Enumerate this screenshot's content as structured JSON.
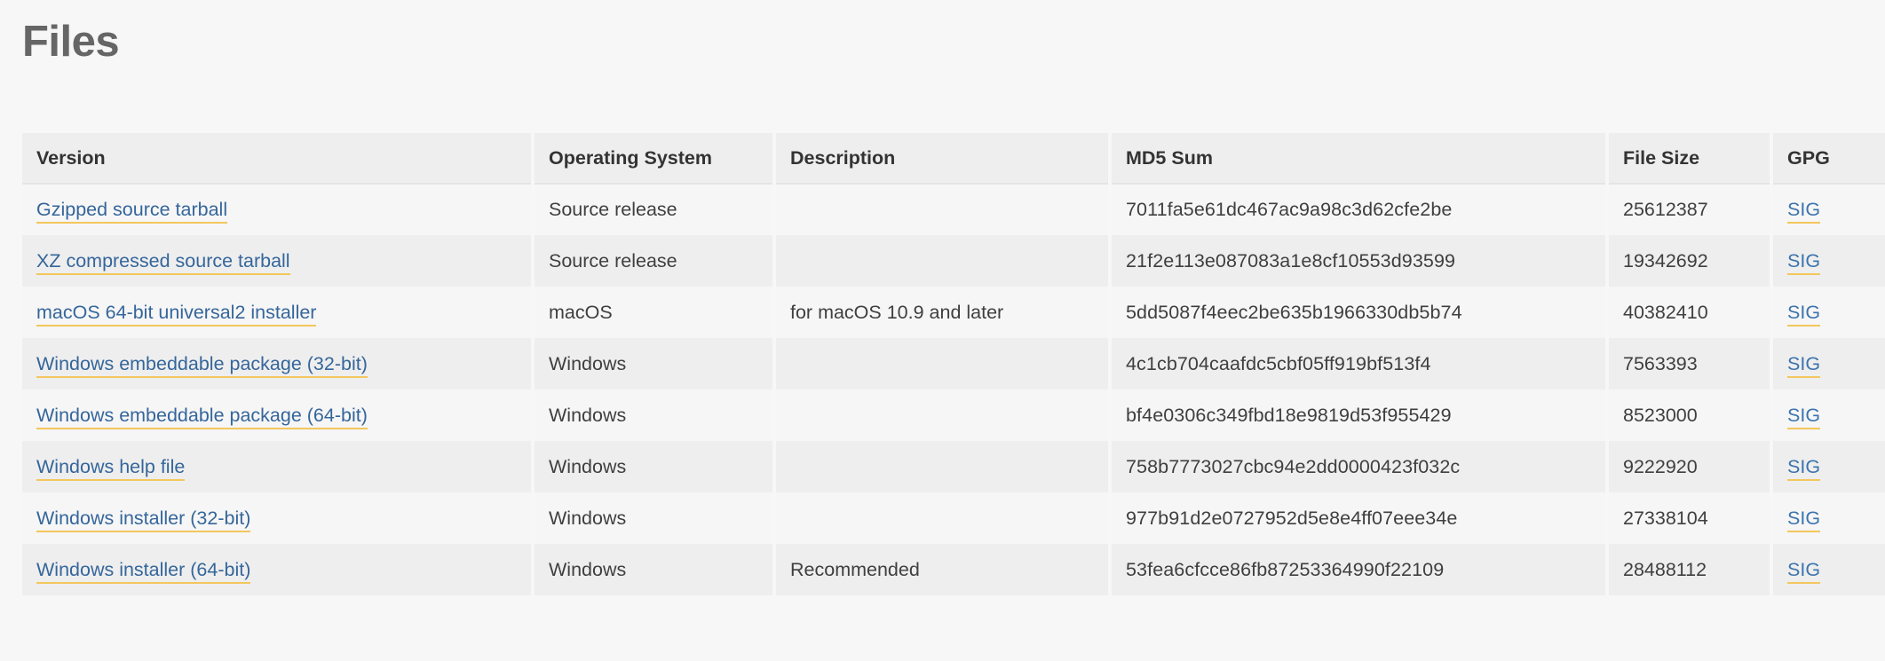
{
  "page": {
    "title": "Files"
  },
  "table": {
    "columns": [
      {
        "key": "version",
        "label": "Version"
      },
      {
        "key": "os",
        "label": "Operating System"
      },
      {
        "key": "description",
        "label": "Description"
      },
      {
        "key": "md5",
        "label": "MD5 Sum"
      },
      {
        "key": "filesize",
        "label": "File Size"
      },
      {
        "key": "gpg",
        "label": "GPG"
      }
    ],
    "gpg_link_label": "SIG",
    "rows": [
      {
        "version": "Gzipped source tarball",
        "os": "Source release",
        "description": "",
        "md5": "7011fa5e61dc467ac9a98c3d62cfe2be",
        "filesize": "25612387",
        "gpg": "SIG"
      },
      {
        "version": "XZ compressed source tarball",
        "os": "Source release",
        "description": "",
        "md5": "21f2e113e087083a1e8cf10553d93599",
        "filesize": "19342692",
        "gpg": "SIG"
      },
      {
        "version": "macOS 64-bit universal2 installer",
        "os": "macOS",
        "description": "for macOS 10.9 and later",
        "md5": "5dd5087f4eec2be635b1966330db5b74",
        "filesize": "40382410",
        "gpg": "SIG"
      },
      {
        "version": "Windows embeddable package (32-bit)",
        "os": "Windows",
        "description": "",
        "md5": "4c1cb704caafdc5cbf05ff919bf513f4",
        "filesize": "7563393",
        "gpg": "SIG"
      },
      {
        "version": "Windows embeddable package (64-bit)",
        "os": "Windows",
        "description": "",
        "md5": "bf4e0306c349fbd18e9819d53f955429",
        "filesize": "8523000",
        "gpg": "SIG"
      },
      {
        "version": "Windows help file",
        "os": "Windows",
        "description": "",
        "md5": "758b7773027cbc94e2dd0000423f032c",
        "filesize": "9222920",
        "gpg": "SIG"
      },
      {
        "version": "Windows installer (32-bit)",
        "os": "Windows",
        "description": "",
        "md5": "977b91d2e0727952d5e8e4ff07eee34e",
        "filesize": "27338104",
        "gpg": "SIG"
      },
      {
        "version": "Windows installer (64-bit)",
        "os": "Windows",
        "description": "Recommended",
        "md5": "53fea6cfcce86fb87253364990f22109",
        "filesize": "28488112",
        "gpg": "SIG"
      }
    ]
  },
  "colors": {
    "page_background": "#f7f7f7",
    "header_background": "#eeeeee",
    "row_odd_background": "#f6f6f6",
    "row_even_background": "#eeeeee",
    "link": "#35669b",
    "link_underline": "#f2c75c",
    "title": "#666666",
    "text": "#3f3f3f"
  }
}
